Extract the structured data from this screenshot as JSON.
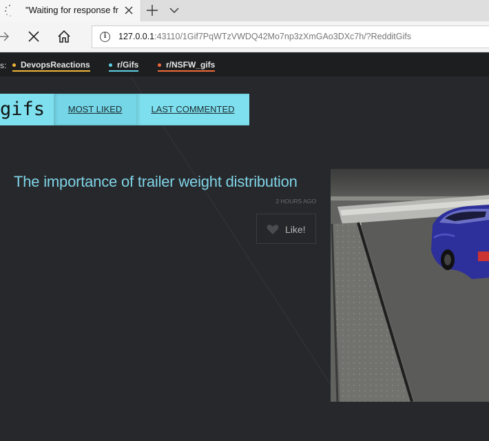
{
  "browser": {
    "tab_title": "\"Waiting for response fr",
    "url_host": "127.0.0.1",
    "url_rest": ":43110/1Gif7PqWTzVWDQ42Mo7np3zXmGAo3DXc7h/?RedditGifs"
  },
  "subreddits": {
    "prefix": "s:",
    "items": [
      {
        "label": "DevopsReactions",
        "color": "#f0b43a"
      },
      {
        "label": "r/Gifs",
        "color": "#5fd0e6"
      },
      {
        "label": "r/NSFW_gifs",
        "color": "#f06a3a"
      }
    ]
  },
  "header": {
    "title": "gifs",
    "tabs": [
      {
        "label": "MOST LIKED"
      },
      {
        "label": "LAST COMMENTED"
      }
    ],
    "accent": "#7ee0ef"
  },
  "post": {
    "title": "The importance of trailer weight distribution",
    "time": "2 HOURS AGO",
    "like_label": "Like!",
    "media_icon": "car-on-trailer-image"
  }
}
